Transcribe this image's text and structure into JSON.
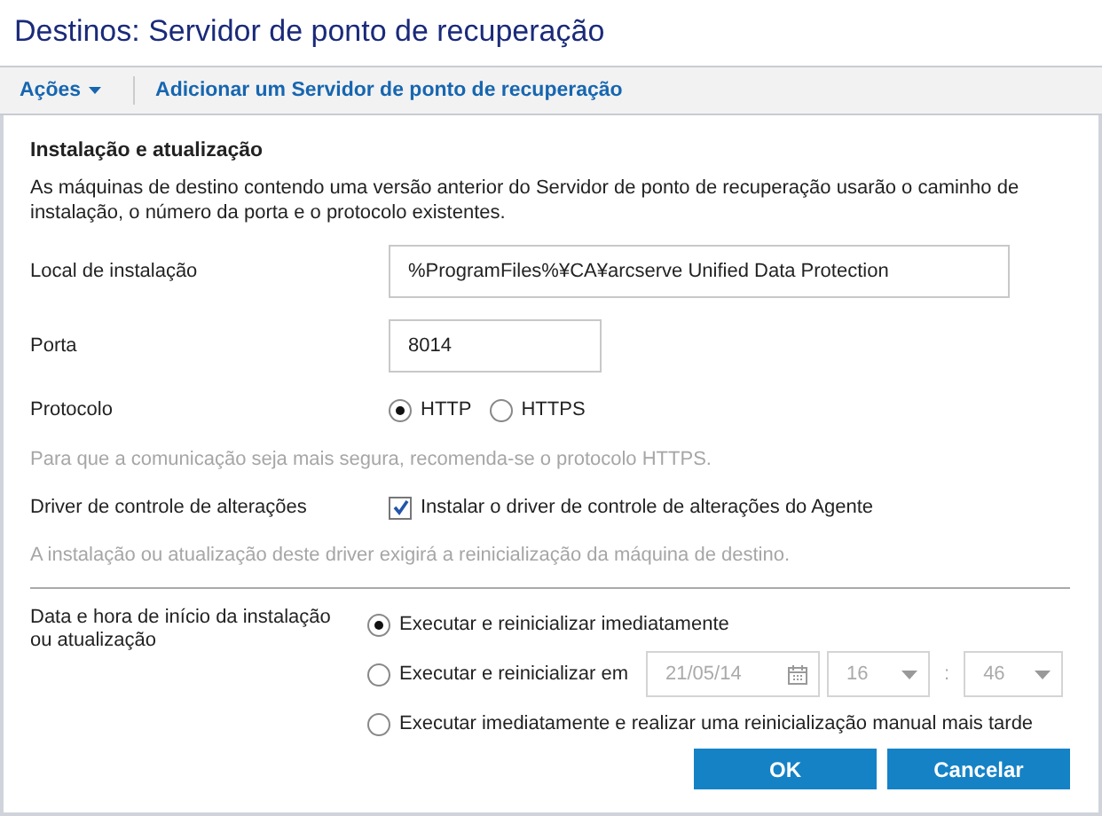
{
  "window": {
    "title": "Destinos: Servidor de ponto de recuperação"
  },
  "toolbar": {
    "menu": "Ações",
    "action": "Adicionar um Servidor de ponto de recuperação"
  },
  "section": {
    "title": "Instalação e atualização",
    "description": "As máquinas de destino contendo uma versão anterior do Servidor de ponto de recuperação usarão o caminho de instalação, o número da porta e o protocolo existentes."
  },
  "install_location": {
    "label": "Local de instalação",
    "value": "%ProgramFiles%¥CA¥arcserve Unified Data Protection"
  },
  "port": {
    "label": "Porta",
    "value": "8014"
  },
  "protocol": {
    "label": "Protocolo",
    "options": [
      {
        "label": "HTTP",
        "selected": true
      },
      {
        "label": "HTTPS",
        "selected": false
      }
    ],
    "hint": "Para que a comunicação seja mais segura, recomenda-se o protocolo HTTPS."
  },
  "driver": {
    "label": "Driver de controle de alterações",
    "option": "Instalar o driver de controle de alterações do Agente",
    "checked": true,
    "hint": "A instalação ou atualização deste driver exigirá a reinicialização da máquina de destino."
  },
  "schedule": {
    "label": "Data e hora de início da instalação ou atualização",
    "options": [
      {
        "label": "Executar e reinicializar imediatamente",
        "selected": true
      },
      {
        "label": "Executar e reinicializar em",
        "selected": false,
        "kind": "datetime",
        "date": "21/05/14",
        "hour": "16",
        "separator": ":",
        "minute": "46",
        "disabled": true
      },
      {
        "label": "Executar imediatamente e realizar uma reinicialização manual mais tarde",
        "selected": false
      }
    ]
  },
  "buttons": [
    "OK",
    "Cancelar"
  ]
}
